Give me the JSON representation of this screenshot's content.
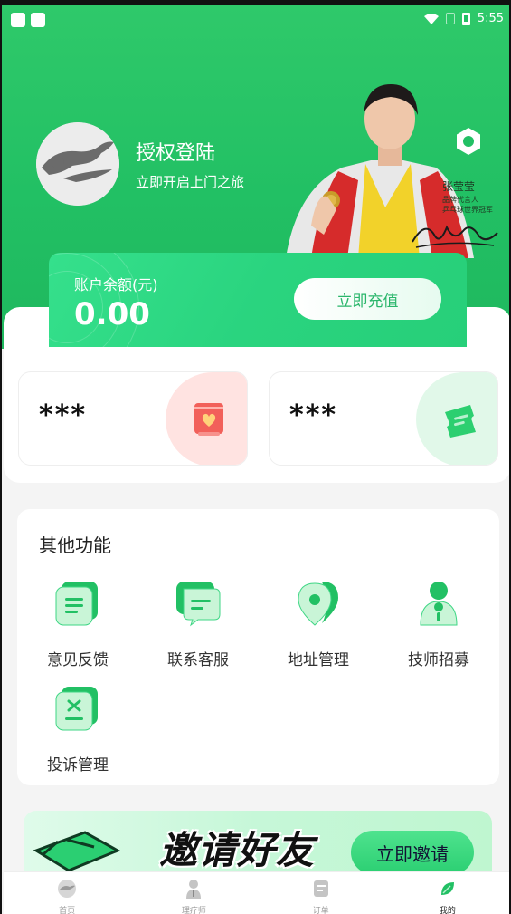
{
  "status_bar": {
    "time": "5:55"
  },
  "header": {
    "login_title": "授权登陆",
    "login_subtitle": "立即开启上门之旅",
    "endorser_name": "张莹莹",
    "endorser_line1": "品牌代言人",
    "endorser_line2": "乒乓球世界冠军"
  },
  "balance": {
    "label": "账户余额(元)",
    "value": "0.00",
    "recharge_label": "立即充值"
  },
  "stats": [
    {
      "value": "***",
      "icon": "gift-card-icon"
    },
    {
      "value": "***",
      "icon": "ticket-icon"
    }
  ],
  "other_functions": {
    "title": "其他功能",
    "items": [
      {
        "label": "意见反馈",
        "icon": "feedback-icon"
      },
      {
        "label": "联系客服",
        "icon": "chat-icon"
      },
      {
        "label": "地址管理",
        "icon": "location-icon"
      },
      {
        "label": "技师招募",
        "icon": "recruit-icon"
      },
      {
        "label": "投诉管理",
        "icon": "complaint-icon"
      }
    ]
  },
  "banner": {
    "title": "邀请好友",
    "button_label": "立即邀请"
  },
  "tabbar": {
    "items": [
      {
        "label": "首页",
        "icon": "home-icon"
      },
      {
        "label": "理疗师",
        "icon": "therapist-icon"
      },
      {
        "label": "订单",
        "icon": "order-icon"
      },
      {
        "label": "我的",
        "icon": "profile-icon"
      }
    ],
    "active_index": 3
  },
  "colors": {
    "brand_green": "#22c064",
    "accent_light": "#35e08c"
  }
}
